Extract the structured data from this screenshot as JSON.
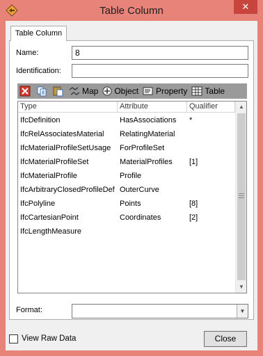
{
  "window": {
    "title": "Table Column",
    "close_glyph": "✕"
  },
  "tabs": [
    {
      "label": "Table Column"
    }
  ],
  "form": {
    "name_label": "Name:",
    "name_value": "8",
    "identification_label": "Identification:",
    "identification_value": "",
    "format_label": "Format:",
    "format_value": ""
  },
  "toolbar": {
    "delete_icon": "delete-icon",
    "copy_icon": "copy-icon",
    "paste_icon": "paste-icon",
    "map_label": "Map",
    "object_label": "Object",
    "property_label": "Property",
    "table_label": "Table"
  },
  "grid": {
    "columns": [
      "Type",
      "Attribute",
      "Qualifier"
    ],
    "rows": [
      {
        "type": "IfcDefinition",
        "attribute": "HasAssociations",
        "qualifier": "*"
      },
      {
        "type": "IfcRelAssociatesMaterial",
        "attribute": "RelatingMaterial",
        "qualifier": ""
      },
      {
        "type": "IfcMaterialProfileSetUsage",
        "attribute": "ForProfileSet",
        "qualifier": ""
      },
      {
        "type": "IfcMaterialProfileSet",
        "attribute": "MaterialProfiles",
        "qualifier": "[1]"
      },
      {
        "type": "IfcMaterialProfile",
        "attribute": "Profile",
        "qualifier": ""
      },
      {
        "type": "IfcArbitraryClosedProfileDef",
        "attribute": "OuterCurve",
        "qualifier": ""
      },
      {
        "type": "IfcPolyline",
        "attribute": "Points",
        "qualifier": "[8]"
      },
      {
        "type": "IfcCartesianPoint",
        "attribute": "Coordinates",
        "qualifier": "[2]"
      },
      {
        "type": "IfcLengthMeasure",
        "attribute": "",
        "qualifier": ""
      }
    ]
  },
  "footer": {
    "view_raw_data_label": "View Raw Data",
    "view_raw_data_checked": false,
    "close_label": "Close"
  },
  "colors": {
    "title_bar": "#e8837a",
    "close_button": "#c7453c",
    "toolbar": "#9a9a9a"
  }
}
